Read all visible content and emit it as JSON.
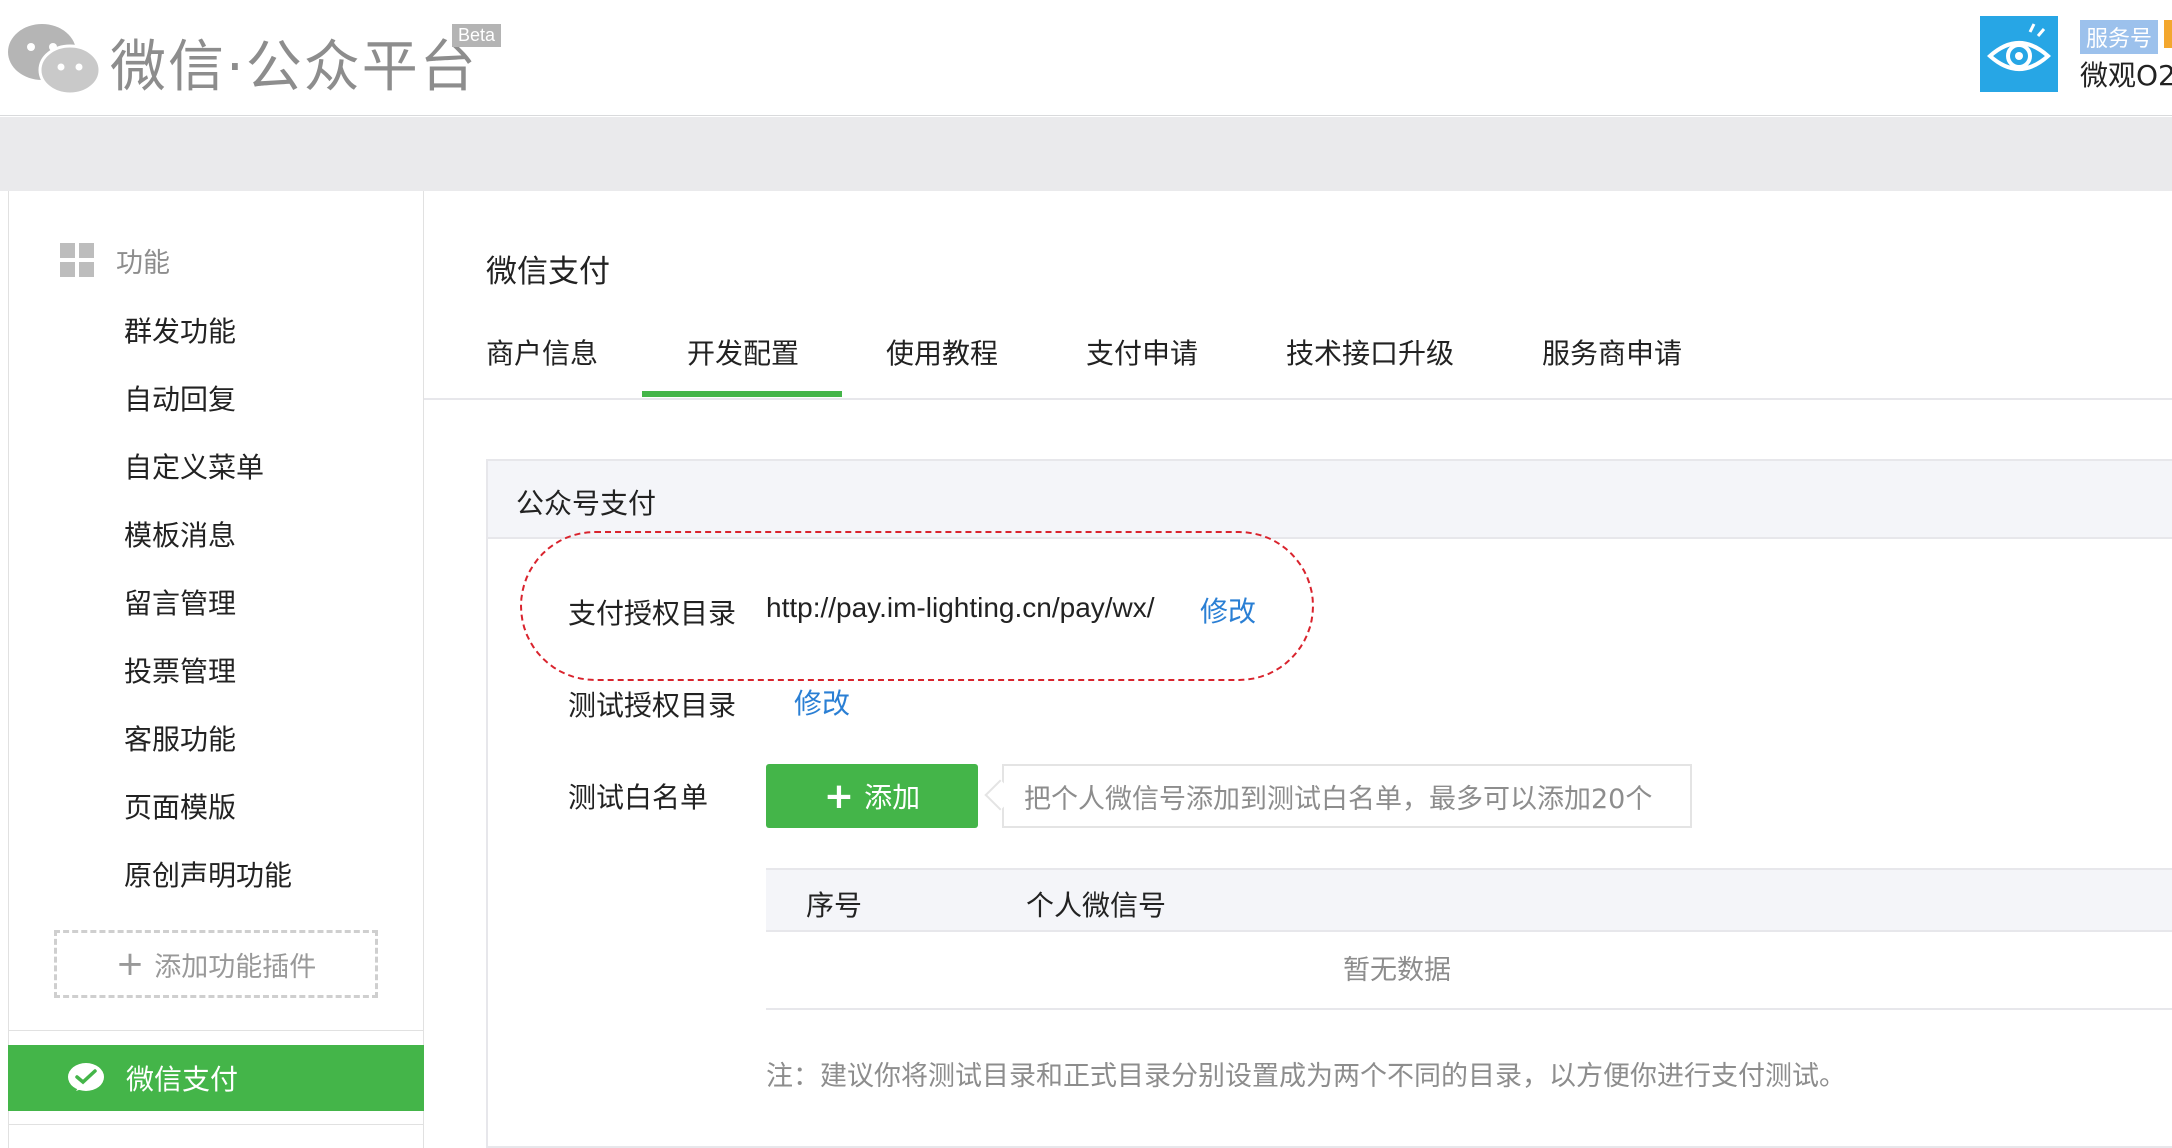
{
  "header": {
    "title": "微信·公众平台",
    "beta": "Beta",
    "account_type": "服务号",
    "account_name": "微观O2"
  },
  "sidebar": {
    "section_label": "功能",
    "items": [
      "群发功能",
      "自动回复",
      "自定义菜单",
      "模板消息",
      "留言管理",
      "投票管理",
      "客服功能",
      "页面模版",
      "原创声明功能"
    ],
    "add_plugin": "添加功能插件",
    "active_item": "微信支付"
  },
  "main": {
    "title": "微信支付",
    "tabs": [
      "商户信息",
      "开发配置",
      "使用教程",
      "支付申请",
      "技术接口升级",
      "服务商申请"
    ],
    "active_tab": "开发配置",
    "panel_title": "公众号支付",
    "pay_dir_label": "支付授权目录",
    "pay_dir_value": "http://pay.im-lighting.cn/pay/wx/",
    "pay_dir_action": "修改",
    "test_dir_label": "测试授权目录",
    "test_dir_action": "修改",
    "whitelist_label": "测试白名单",
    "add_button": "添加",
    "whitelist_tip": "把个人微信号添加到测试白名单，最多可以添加20个",
    "table": {
      "columns": [
        "序号",
        "个人微信号"
      ],
      "empty_text": "暂无数据"
    },
    "note": "注：建议你将测试目录和正式目录分别设置成为两个不同的目录，以方便你进行支付测试。"
  },
  "colors": {
    "accent_green": "#44b549",
    "link_blue": "#2a7fd4",
    "highlight_red": "#d9232d"
  }
}
